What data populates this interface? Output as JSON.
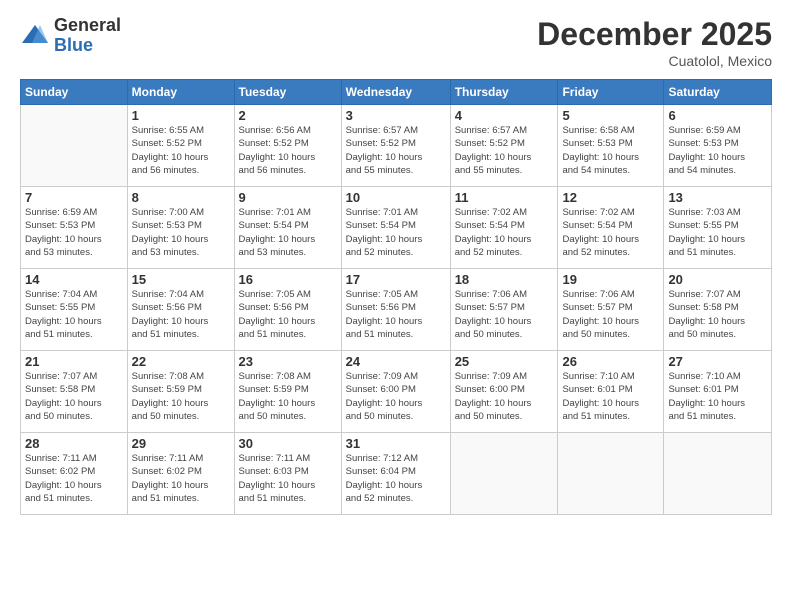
{
  "logo": {
    "general": "General",
    "blue": "Blue"
  },
  "header": {
    "month": "December 2025",
    "location": "Cuatolol, Mexico"
  },
  "weekdays": [
    "Sunday",
    "Monday",
    "Tuesday",
    "Wednesday",
    "Thursday",
    "Friday",
    "Saturday"
  ],
  "weeks": [
    [
      {
        "day": "",
        "info": ""
      },
      {
        "day": "1",
        "info": "Sunrise: 6:55 AM\nSunset: 5:52 PM\nDaylight: 10 hours\nand 56 minutes."
      },
      {
        "day": "2",
        "info": "Sunrise: 6:56 AM\nSunset: 5:52 PM\nDaylight: 10 hours\nand 56 minutes."
      },
      {
        "day": "3",
        "info": "Sunrise: 6:57 AM\nSunset: 5:52 PM\nDaylight: 10 hours\nand 55 minutes."
      },
      {
        "day": "4",
        "info": "Sunrise: 6:57 AM\nSunset: 5:52 PM\nDaylight: 10 hours\nand 55 minutes."
      },
      {
        "day": "5",
        "info": "Sunrise: 6:58 AM\nSunset: 5:53 PM\nDaylight: 10 hours\nand 54 minutes."
      },
      {
        "day": "6",
        "info": "Sunrise: 6:59 AM\nSunset: 5:53 PM\nDaylight: 10 hours\nand 54 minutes."
      }
    ],
    [
      {
        "day": "7",
        "info": "Sunrise: 6:59 AM\nSunset: 5:53 PM\nDaylight: 10 hours\nand 53 minutes."
      },
      {
        "day": "8",
        "info": "Sunrise: 7:00 AM\nSunset: 5:53 PM\nDaylight: 10 hours\nand 53 minutes."
      },
      {
        "day": "9",
        "info": "Sunrise: 7:01 AM\nSunset: 5:54 PM\nDaylight: 10 hours\nand 53 minutes."
      },
      {
        "day": "10",
        "info": "Sunrise: 7:01 AM\nSunset: 5:54 PM\nDaylight: 10 hours\nand 52 minutes."
      },
      {
        "day": "11",
        "info": "Sunrise: 7:02 AM\nSunset: 5:54 PM\nDaylight: 10 hours\nand 52 minutes."
      },
      {
        "day": "12",
        "info": "Sunrise: 7:02 AM\nSunset: 5:54 PM\nDaylight: 10 hours\nand 52 minutes."
      },
      {
        "day": "13",
        "info": "Sunrise: 7:03 AM\nSunset: 5:55 PM\nDaylight: 10 hours\nand 51 minutes."
      }
    ],
    [
      {
        "day": "14",
        "info": "Sunrise: 7:04 AM\nSunset: 5:55 PM\nDaylight: 10 hours\nand 51 minutes."
      },
      {
        "day": "15",
        "info": "Sunrise: 7:04 AM\nSunset: 5:56 PM\nDaylight: 10 hours\nand 51 minutes."
      },
      {
        "day": "16",
        "info": "Sunrise: 7:05 AM\nSunset: 5:56 PM\nDaylight: 10 hours\nand 51 minutes."
      },
      {
        "day": "17",
        "info": "Sunrise: 7:05 AM\nSunset: 5:56 PM\nDaylight: 10 hours\nand 51 minutes."
      },
      {
        "day": "18",
        "info": "Sunrise: 7:06 AM\nSunset: 5:57 PM\nDaylight: 10 hours\nand 50 minutes."
      },
      {
        "day": "19",
        "info": "Sunrise: 7:06 AM\nSunset: 5:57 PM\nDaylight: 10 hours\nand 50 minutes."
      },
      {
        "day": "20",
        "info": "Sunrise: 7:07 AM\nSunset: 5:58 PM\nDaylight: 10 hours\nand 50 minutes."
      }
    ],
    [
      {
        "day": "21",
        "info": "Sunrise: 7:07 AM\nSunset: 5:58 PM\nDaylight: 10 hours\nand 50 minutes."
      },
      {
        "day": "22",
        "info": "Sunrise: 7:08 AM\nSunset: 5:59 PM\nDaylight: 10 hours\nand 50 minutes."
      },
      {
        "day": "23",
        "info": "Sunrise: 7:08 AM\nSunset: 5:59 PM\nDaylight: 10 hours\nand 50 minutes."
      },
      {
        "day": "24",
        "info": "Sunrise: 7:09 AM\nSunset: 6:00 PM\nDaylight: 10 hours\nand 50 minutes."
      },
      {
        "day": "25",
        "info": "Sunrise: 7:09 AM\nSunset: 6:00 PM\nDaylight: 10 hours\nand 50 minutes."
      },
      {
        "day": "26",
        "info": "Sunrise: 7:10 AM\nSunset: 6:01 PM\nDaylight: 10 hours\nand 51 minutes."
      },
      {
        "day": "27",
        "info": "Sunrise: 7:10 AM\nSunset: 6:01 PM\nDaylight: 10 hours\nand 51 minutes."
      }
    ],
    [
      {
        "day": "28",
        "info": "Sunrise: 7:11 AM\nSunset: 6:02 PM\nDaylight: 10 hours\nand 51 minutes."
      },
      {
        "day": "29",
        "info": "Sunrise: 7:11 AM\nSunset: 6:02 PM\nDaylight: 10 hours\nand 51 minutes."
      },
      {
        "day": "30",
        "info": "Sunrise: 7:11 AM\nSunset: 6:03 PM\nDaylight: 10 hours\nand 51 minutes."
      },
      {
        "day": "31",
        "info": "Sunrise: 7:12 AM\nSunset: 6:04 PM\nDaylight: 10 hours\nand 52 minutes."
      },
      {
        "day": "",
        "info": ""
      },
      {
        "day": "",
        "info": ""
      },
      {
        "day": "",
        "info": ""
      }
    ]
  ]
}
